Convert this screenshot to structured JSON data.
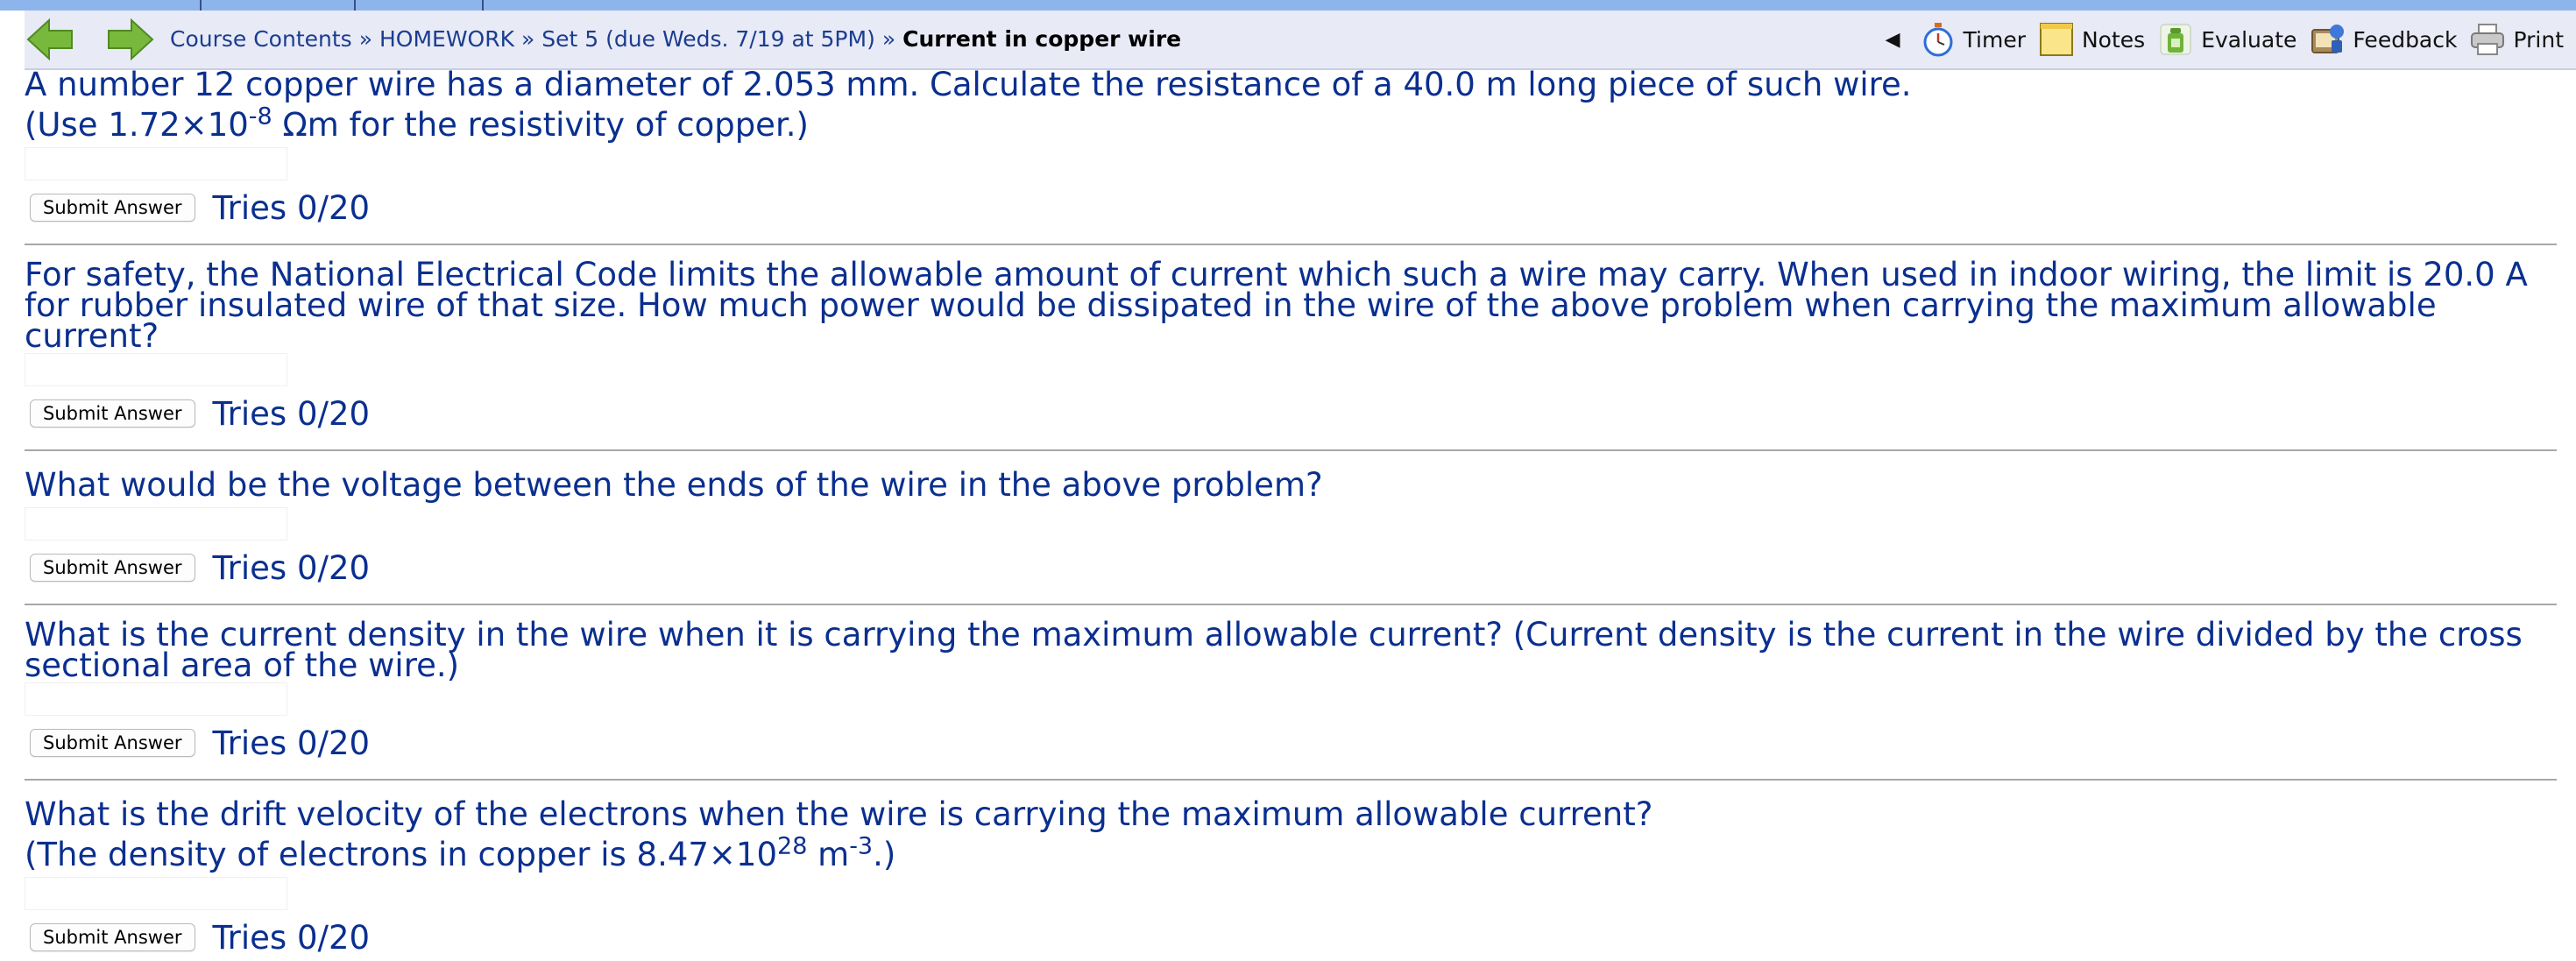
{
  "nav": {
    "back_label": "Back",
    "forward_label": "Forward",
    "breadcrumbs": [
      "Course Contents",
      "HOMEWORK",
      "Set 5 (due Weds. 7/19 at 5PM)"
    ],
    "separator": "»",
    "current": "Current in copper wire",
    "collapse_glyph": "◀",
    "tools": [
      {
        "label": "Timer",
        "icon": "stopwatch-icon"
      },
      {
        "label": "Notes",
        "icon": "notepad-icon"
      },
      {
        "label": "Evaluate",
        "icon": "checklist-icon"
      },
      {
        "label": "Feedback",
        "icon": "feedback-icon"
      },
      {
        "label": "Print",
        "icon": "printer-icon"
      }
    ]
  },
  "colors": {
    "top_strip": "#8eb4ec",
    "navbar_bg": "#e8eaf6",
    "question_text": "#0a2f8f",
    "arrow_green": "#78b83c"
  },
  "questions": [
    {
      "line1": "A number 12 copper wire has a diameter of 2.053 mm. Calculate the resistance of a 40.0 m long piece of such wire.",
      "line2_pre": "(Use 1.72×10",
      "line2_sup": "-8",
      "line2_post": " Ωm for the resistivity of copper.)",
      "submit_label": "Submit Answer",
      "tries": "Tries 0/20"
    },
    {
      "text": "For safety, the National Electrical Code limits the allowable amount of current which such a wire may carry. When used in indoor wiring, the limit is 20.0 A for rubber insulated wire of that size. How much power would be dissipated in the wire of the above problem when carrying the maximum allowable current?",
      "submit_label": "Submit Answer",
      "tries": "Tries 0/20"
    },
    {
      "text": "What would be the voltage between the ends of the wire in the above problem?",
      "submit_label": "Submit Answer",
      "tries": "Tries 0/20"
    },
    {
      "text": "What is the current density in the wire when it is carrying the maximum allowable current? (Current density is the current in the wire divided by the cross sectional area of the wire.)",
      "submit_label": "Submit Answer",
      "tries": "Tries 0/20"
    },
    {
      "line1": "What is the drift velocity of the electrons when the wire is carrying the maximum allowable current?",
      "line2_pre": "(The density of electrons in copper is 8.47×10",
      "line2_sup": "28",
      "line2_mid": " m",
      "line2_sup2": "-3",
      "line2_post": ".)",
      "submit_label": "Submit Answer",
      "tries": "Tries 0/20"
    }
  ]
}
